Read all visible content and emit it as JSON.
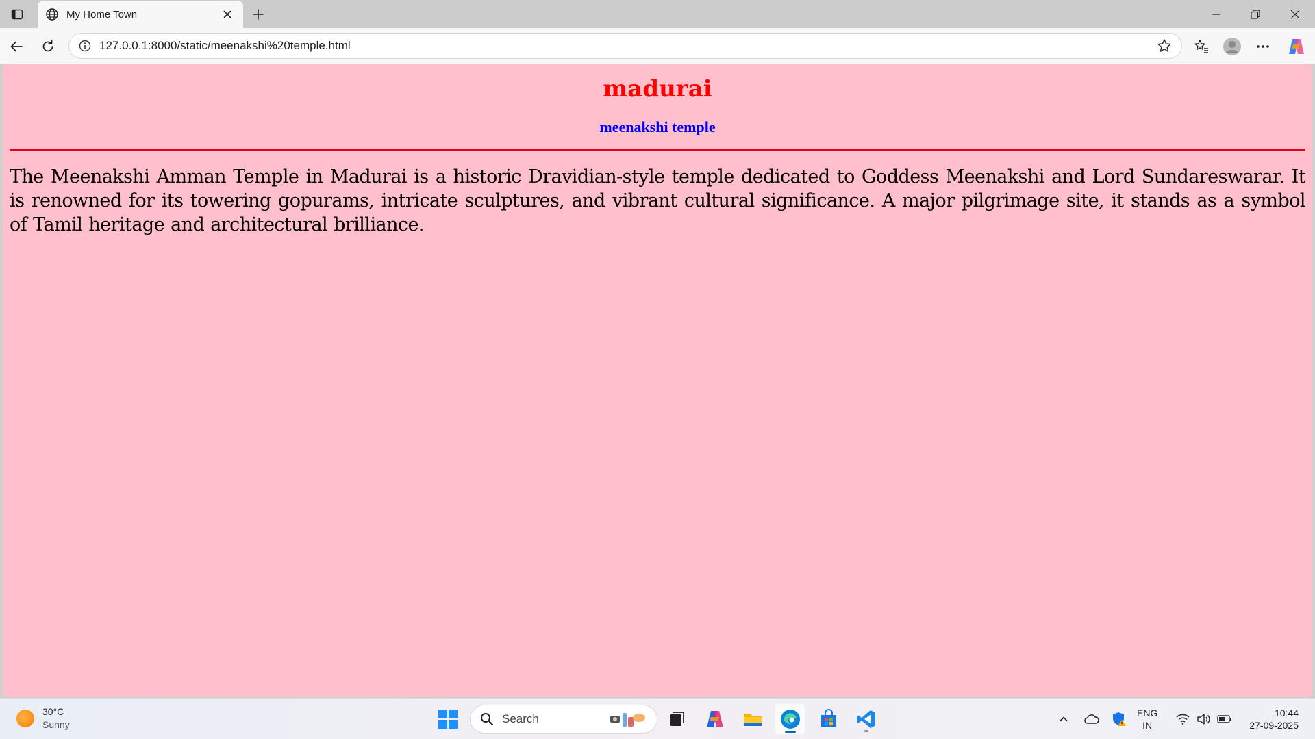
{
  "browser": {
    "tab": {
      "title": "My Home Town"
    },
    "address": {
      "url": "127.0.0.1:8000/static/meenakshi%20temple.html"
    }
  },
  "page": {
    "heading": "madurai",
    "subheading": "meenakshi temple",
    "paragraph": "The Meenakshi Amman Temple in Madurai is a historic Dravidian-style temple dedicated to Goddess Meenakshi and Lord Sundareswarar. It is renowned for its towering gopurams, intricate sculptures, and vibrant cultural significance. A major pilgrimage site, it stands as a symbol of Tamil heritage and architectural brilliance.",
    "colors": {
      "background": "#ffc0cb",
      "heading": "#ff0000",
      "subheading": "#0000ff",
      "rule": "#e4000f"
    }
  },
  "taskbar": {
    "weather": {
      "temp": "30°C",
      "condition": "Sunny"
    },
    "search": {
      "label": "Search"
    },
    "language": {
      "line1": "ENG",
      "line2": "IN"
    },
    "clock": {
      "time": "10:44",
      "date": "27-09-2025"
    },
    "apps": [
      "windows-start-icon",
      "search-icon",
      "task-view-icon",
      "copilot-icon",
      "file-explorer-icon",
      "edge-icon",
      "microsoft-store-icon",
      "vscode-icon"
    ]
  }
}
